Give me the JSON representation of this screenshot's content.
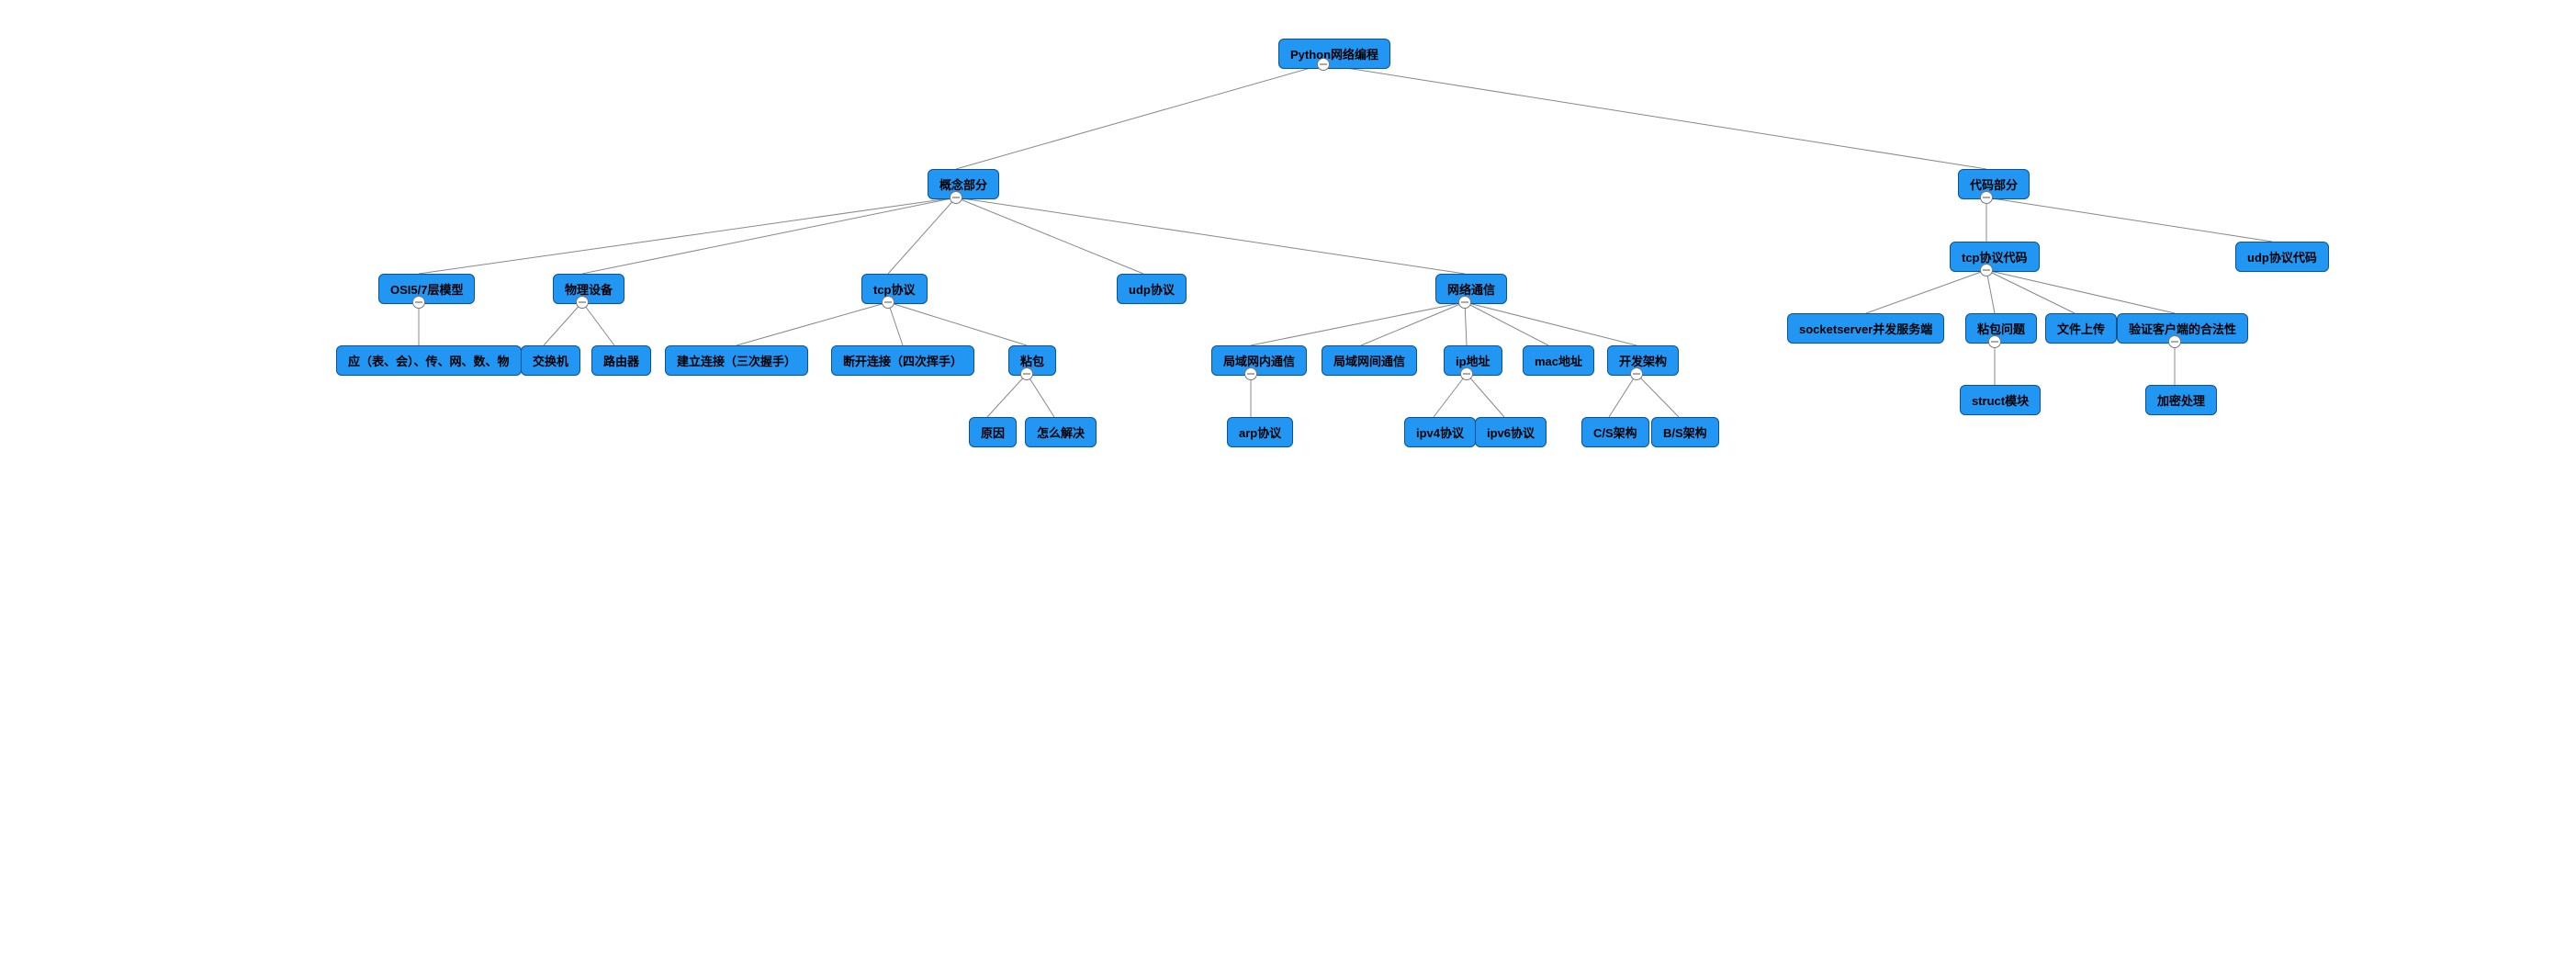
{
  "chart_data": {
    "type": "tree",
    "root": "Python网络编程",
    "children": [
      {
        "label": "概念部分",
        "children": [
          {
            "label": "OSI5/7层模型",
            "children": [
              {
                "label": "应（表、会）、传、网、数、物"
              }
            ]
          },
          {
            "label": "物理设备",
            "children": [
              {
                "label": "交换机"
              },
              {
                "label": "路由器"
              }
            ]
          },
          {
            "label": "tcp协议",
            "children": [
              {
                "label": "建立连接（三次握手）"
              },
              {
                "label": "断开连接（四次挥手）"
              },
              {
                "label": "粘包",
                "children": [
                  {
                    "label": "原因"
                  },
                  {
                    "label": "怎么解决"
                  }
                ]
              }
            ]
          },
          {
            "label": "udp协议"
          },
          {
            "label": "网络通信",
            "children": [
              {
                "label": "局域网内通信",
                "children": [
                  {
                    "label": "arp协议"
                  }
                ]
              },
              {
                "label": "局域网间通信"
              },
              {
                "label": "ip地址",
                "children": [
                  {
                    "label": "ipv4协议"
                  },
                  {
                    "label": "ipv6协议"
                  }
                ]
              },
              {
                "label": "mac地址"
              },
              {
                "label": "开发架构",
                "children": [
                  {
                    "label": "C/S架构"
                  },
                  {
                    "label": "B/S架构"
                  }
                ]
              }
            ]
          }
        ]
      },
      {
        "label": "代码部分",
        "children": [
          {
            "label": "tcp协议代码",
            "children": [
              {
                "label": "socketserver并发服务端"
              },
              {
                "label": "粘包问题",
                "children": [
                  {
                    "label": "struct模块"
                  }
                ]
              },
              {
                "label": "文件上传"
              },
              {
                "label": "验证客户端的合法性",
                "children": [
                  {
                    "label": "加密处理"
                  }
                ]
              }
            ]
          },
          {
            "label": "udp协议代码"
          }
        ]
      }
    ]
  },
  "nodes": {
    "root": "Python网络编程",
    "concept": "概念部分",
    "code": "代码部分",
    "osi": "OSI5/7层模型",
    "osi_layers": "应（表、会）、传、网、数、物",
    "device": "物理设备",
    "switch": "交换机",
    "router": "路由器",
    "tcp": "tcp协议",
    "tcp_connect": "建立连接（三次握手）",
    "tcp_disconnect": "断开连接（四次挥手）",
    "sticky": "粘包",
    "sticky_reason": "原因",
    "sticky_solve": "怎么解决",
    "udp": "udp协议",
    "netcom": "网络通信",
    "lan_in": "局域网内通信",
    "arp": "arp协议",
    "lan_out": "局域网间通信",
    "ipaddr": "ip地址",
    "ipv4": "ipv4协议",
    "ipv6": "ipv6协议",
    "mac": "mac地址",
    "arch": "开发架构",
    "cs": "C/S架构",
    "bs": "B/S架构",
    "tcp_code": "tcp协议代码",
    "ss_server": "socketserver并发服务端",
    "sticky_pkg": "粘包问题",
    "struct_mod": "struct模块",
    "file_upload": "文件上传",
    "verify_client": "验证客户端的合法性",
    "encrypt": "加密处理",
    "udp_code": "udp协议代码"
  },
  "colors": {
    "node_fill": "#2196f3",
    "node_border": "#0b5394",
    "edge": "#888888"
  }
}
